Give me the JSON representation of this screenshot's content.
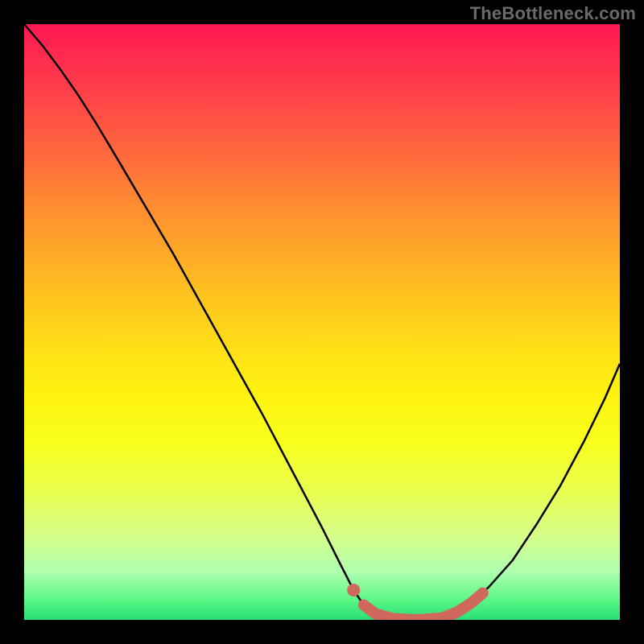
{
  "watermark": "TheBottleneck.com",
  "chart_data": {
    "type": "line",
    "title": "",
    "xlabel": "",
    "ylabel": "",
    "xlim": [
      0,
      1
    ],
    "ylim": [
      0,
      1
    ],
    "series": [
      {
        "name": "curve",
        "stroke": "#000000",
        "stroke_width": 2.5,
        "points": [
          {
            "x": 0.0,
            "y": 1.0
          },
          {
            "x": 0.03,
            "y": 0.965
          },
          {
            "x": 0.06,
            "y": 0.925
          },
          {
            "x": 0.09,
            "y": 0.882
          },
          {
            "x": 0.12,
            "y": 0.835
          },
          {
            "x": 0.16,
            "y": 0.768
          },
          {
            "x": 0.2,
            "y": 0.7
          },
          {
            "x": 0.25,
            "y": 0.615
          },
          {
            "x": 0.3,
            "y": 0.525
          },
          {
            "x": 0.35,
            "y": 0.435
          },
          {
            "x": 0.4,
            "y": 0.345
          },
          {
            "x": 0.45,
            "y": 0.25
          },
          {
            "x": 0.5,
            "y": 0.155
          },
          {
            "x": 0.53,
            "y": 0.095
          },
          {
            "x": 0.553,
            "y": 0.05
          },
          {
            "x": 0.57,
            "y": 0.025
          },
          {
            "x": 0.59,
            "y": 0.01
          },
          {
            "x": 0.62,
            "y": 0.002
          },
          {
            "x": 0.66,
            "y": 0.0
          },
          {
            "x": 0.7,
            "y": 0.003
          },
          {
            "x": 0.725,
            "y": 0.012
          },
          {
            "x": 0.75,
            "y": 0.028
          },
          {
            "x": 0.78,
            "y": 0.055
          },
          {
            "x": 0.82,
            "y": 0.1
          },
          {
            "x": 0.86,
            "y": 0.16
          },
          {
            "x": 0.9,
            "y": 0.225
          },
          {
            "x": 0.94,
            "y": 0.3
          },
          {
            "x": 0.975,
            "y": 0.372
          },
          {
            "x": 1.0,
            "y": 0.43
          }
        ]
      },
      {
        "name": "highlight",
        "stroke": "#d1685e",
        "stroke_width": 14,
        "linecap": "round",
        "points": [
          {
            "x": 0.57,
            "y": 0.025
          },
          {
            "x": 0.59,
            "y": 0.01
          },
          {
            "x": 0.62,
            "y": 0.002
          },
          {
            "x": 0.66,
            "y": 0.0
          },
          {
            "x": 0.7,
            "y": 0.003
          },
          {
            "x": 0.725,
            "y": 0.012
          },
          {
            "x": 0.75,
            "y": 0.028
          },
          {
            "x": 0.77,
            "y": 0.045
          }
        ]
      }
    ],
    "markers": [
      {
        "name": "highlight-dot",
        "x": 0.553,
        "y": 0.05,
        "r": 8,
        "fill": "#d1685e"
      }
    ]
  }
}
